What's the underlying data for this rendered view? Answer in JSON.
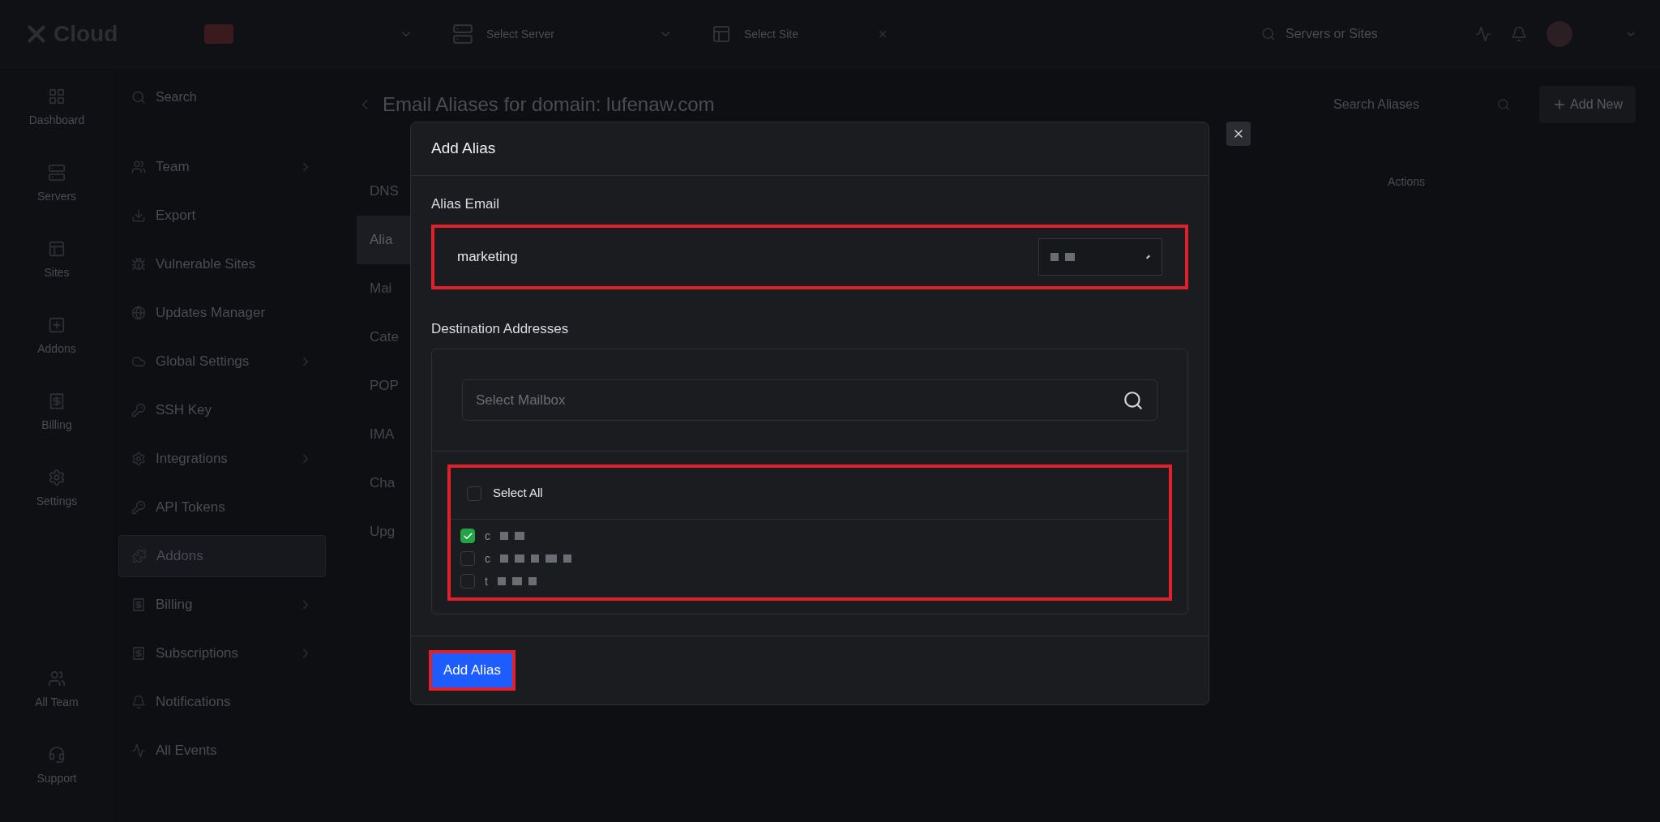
{
  "topbar": {
    "logo": "Cloud",
    "server_select": "Select Server",
    "site_select": "Select Site",
    "search_placeholder": "Servers or Sites"
  },
  "rail": [
    {
      "label": "Dashboard"
    },
    {
      "label": "Servers"
    },
    {
      "label": "Sites"
    },
    {
      "label": "Addons"
    },
    {
      "label": "Billing"
    },
    {
      "label": "Settings"
    }
  ],
  "rail_bottom": [
    {
      "label": "All Team"
    },
    {
      "label": "Support"
    }
  ],
  "settings_menu": {
    "search_placeholder": "Search",
    "items": [
      {
        "label": "Team",
        "expandable": true,
        "selected": false
      },
      {
        "label": "Export",
        "expandable": false,
        "selected": false
      },
      {
        "label": "Vulnerable Sites",
        "expandable": false,
        "selected": false
      },
      {
        "label": "Updates Manager",
        "expandable": false,
        "selected": false
      },
      {
        "label": "Global Settings",
        "expandable": true,
        "selected": false
      },
      {
        "label": "SSH Key",
        "expandable": false,
        "selected": false
      },
      {
        "label": "Integrations",
        "expandable": true,
        "selected": false
      },
      {
        "label": "API Tokens",
        "expandable": false,
        "selected": false
      },
      {
        "label": "Addons",
        "expandable": false,
        "selected": true
      },
      {
        "label": "Billing",
        "expandable": true,
        "selected": false
      },
      {
        "label": "Subscriptions",
        "expandable": true,
        "selected": false
      },
      {
        "label": "Notifications",
        "expandable": false,
        "selected": false
      },
      {
        "label": "All Events",
        "expandable": false,
        "selected": false
      }
    ]
  },
  "page": {
    "title": "Email Aliases for domain: lufenaw.com",
    "search_placeholder": "Search Aliases",
    "add_button": "Add New",
    "column_heading": "Actions",
    "tabs": [
      {
        "label": "DNS",
        "selected": false
      },
      {
        "label": "Alia",
        "selected": true
      },
      {
        "label": "Mai",
        "selected": false
      },
      {
        "label": "Cate",
        "selected": false
      },
      {
        "label": "POP",
        "selected": false
      },
      {
        "label": "IMA",
        "selected": false
      },
      {
        "label": "Cha",
        "selected": false
      },
      {
        "label": "Upg",
        "selected": false
      }
    ]
  },
  "modal": {
    "title": "Add Alias",
    "alias_label": "Alias Email",
    "alias_value": "marketing",
    "destination_label": "Destination Addresses",
    "mailbox_placeholder": "Select Mailbox",
    "select_all": {
      "label": "Select All",
      "checked": false
    },
    "mailboxes": [
      {
        "label": "c",
        "checked": true
      },
      {
        "label": "c",
        "checked": false
      },
      {
        "label": "t",
        "checked": false
      }
    ],
    "submit": "Add Alias"
  }
}
